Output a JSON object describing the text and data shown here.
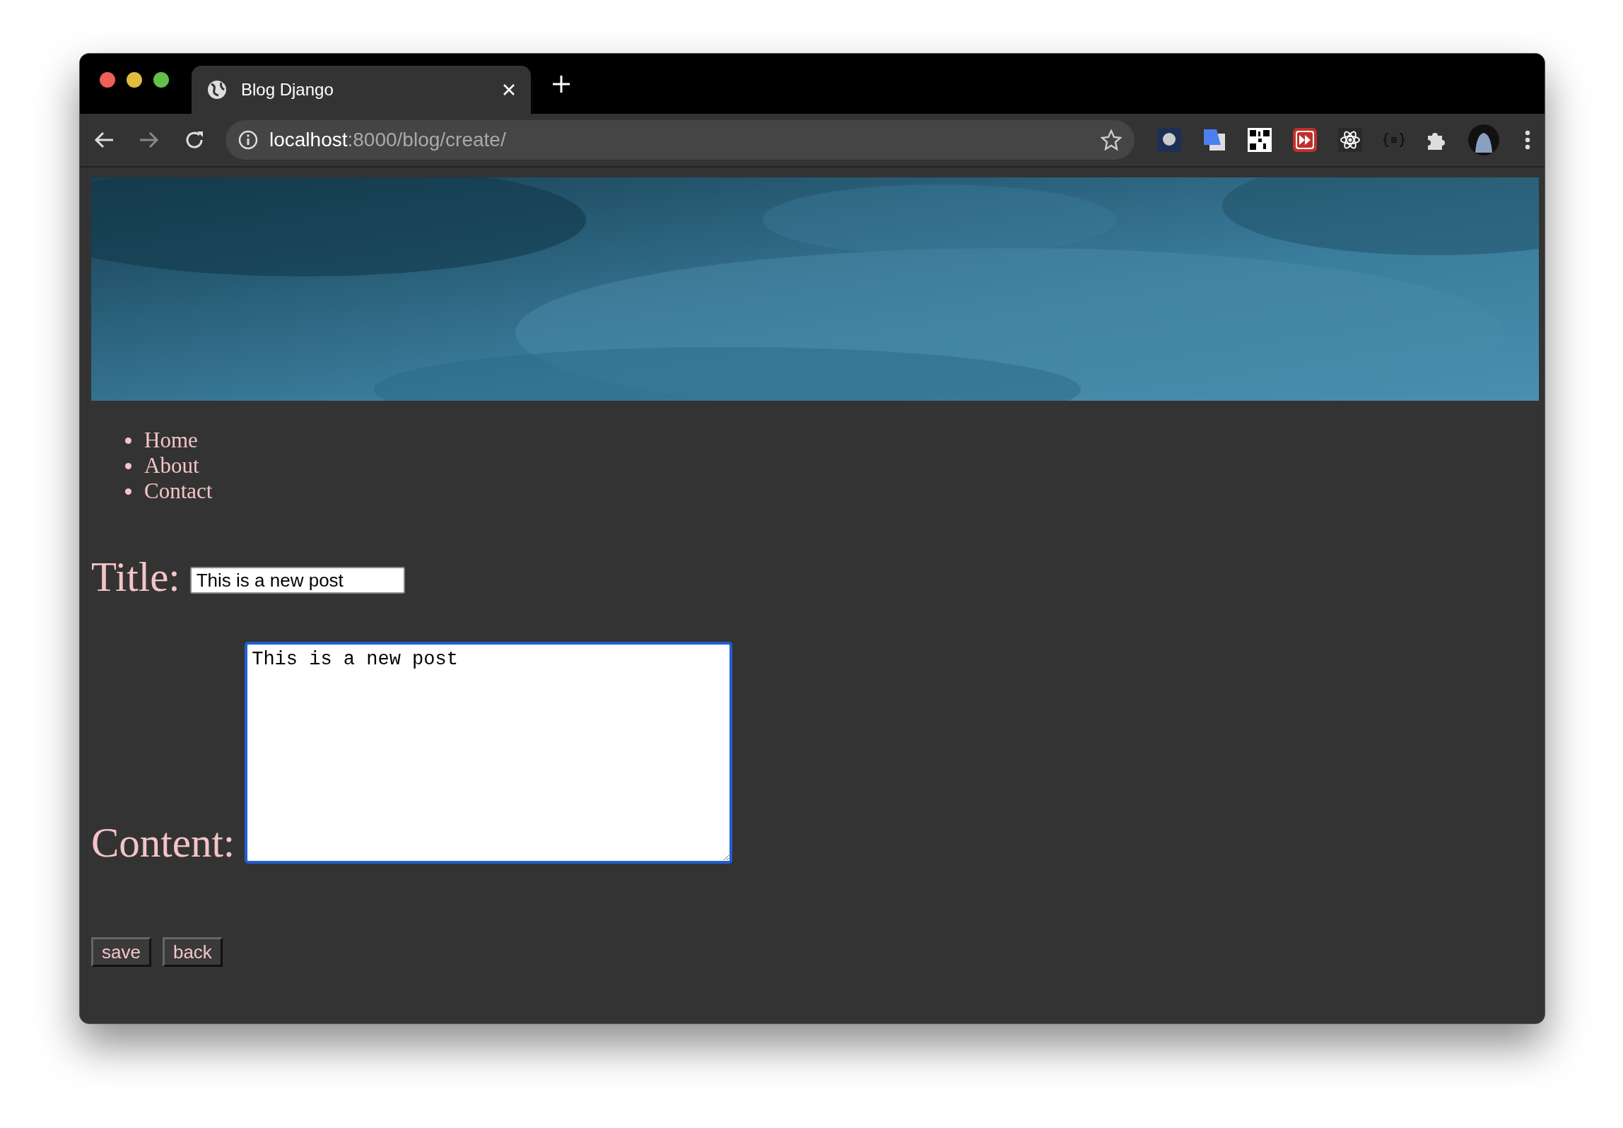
{
  "browser": {
    "tabs": [
      {
        "title": "Blog Django",
        "selected": true
      }
    ],
    "address": {
      "host": "localhost",
      "path": ":8000/blog/create/"
    },
    "extensions": [
      {
        "kind": "moon"
      },
      {
        "kind": "translate"
      },
      {
        "kind": "qr"
      },
      {
        "kind": "fastforward"
      },
      {
        "kind": "atom"
      },
      {
        "kind": "json"
      },
      {
        "kind": "puzzle"
      },
      {
        "kind": "avatar"
      }
    ]
  },
  "nav": [
    {
      "label": "Home"
    },
    {
      "label": "About"
    },
    {
      "label": "Contact"
    }
  ],
  "form": {
    "title": {
      "label": "Title:",
      "value": "This is a new post"
    },
    "content": {
      "label": "Content:",
      "value": "This is a new post",
      "focused": true
    },
    "buttons": [
      "save",
      "back"
    ]
  }
}
